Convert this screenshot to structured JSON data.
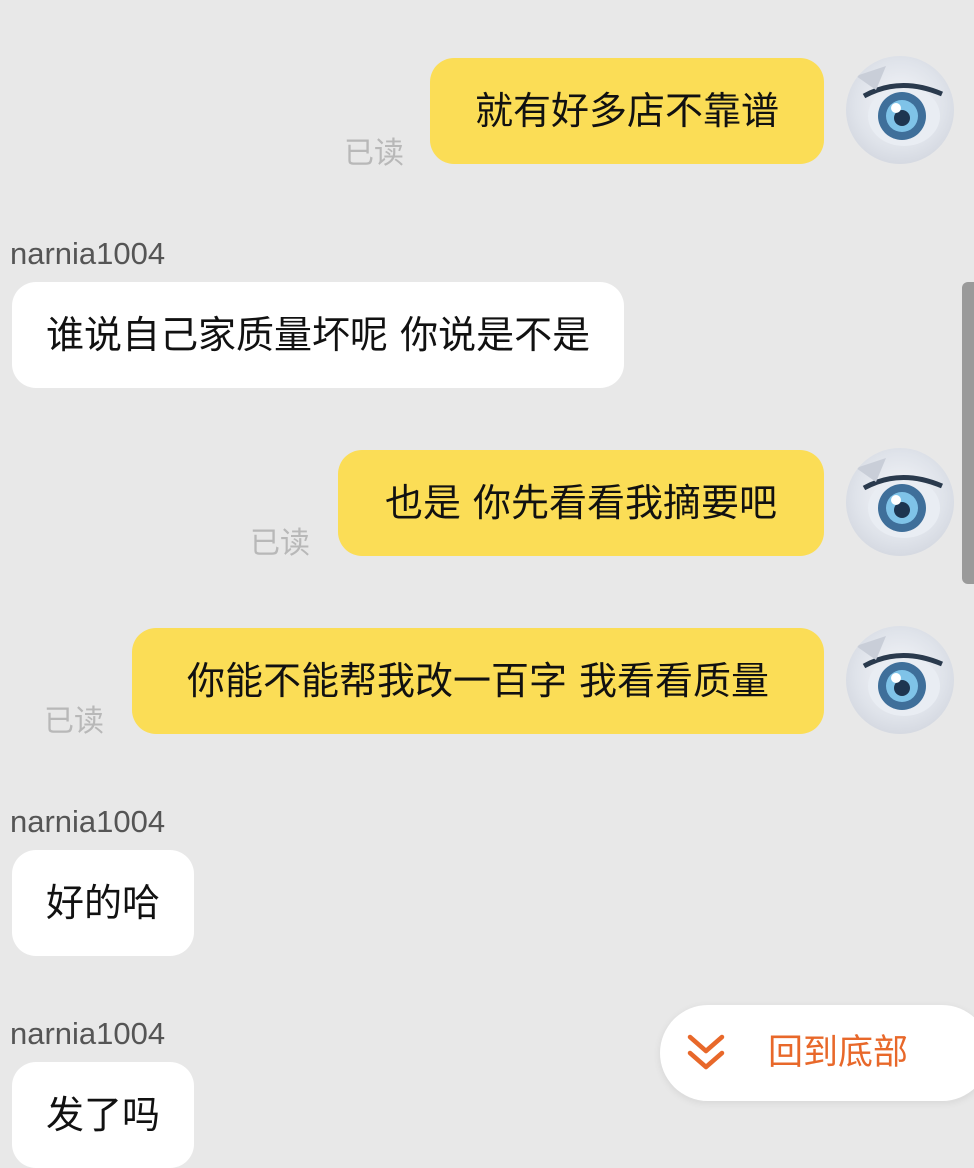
{
  "colors": {
    "background": "#e8e8e8",
    "outgoing_bubble": "#fbdd56",
    "incoming_bubble": "#ffffff",
    "read_receipt": "#b8b8b8",
    "accent": "#e8682a"
  },
  "messages": [
    {
      "direction": "out",
      "text": "就有好多店不靠谱",
      "status": "已读",
      "avatar_icon": "anime-eye-avatar"
    },
    {
      "direction": "in",
      "sender": "narnia1004",
      "text": "谁说自己家质量坏呢 你说是不是"
    },
    {
      "direction": "out",
      "text": "也是 你先看看我摘要吧",
      "status": "已读",
      "avatar_icon": "anime-eye-avatar"
    },
    {
      "direction": "out",
      "text": "你能不能帮我改一百字 我看看质量",
      "status": "已读",
      "avatar_icon": "anime-eye-avatar"
    },
    {
      "direction": "in",
      "sender": "narnia1004",
      "text": "好的哈"
    },
    {
      "direction": "in",
      "sender": "narnia1004",
      "text": "发了吗"
    }
  ],
  "back_to_bottom": {
    "label": "回到底部",
    "icon": "double-chevron-down-icon"
  }
}
